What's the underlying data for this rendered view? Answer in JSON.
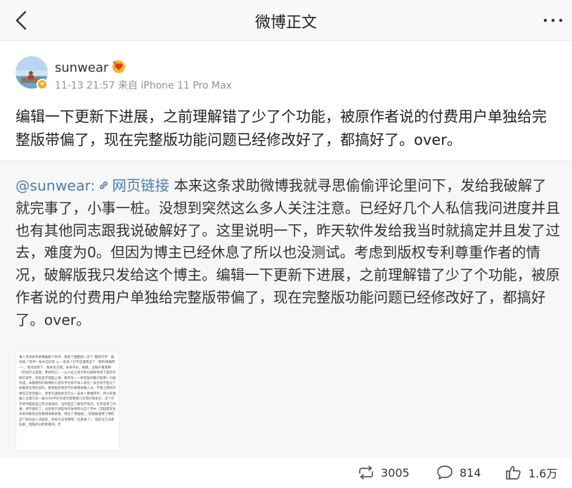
{
  "nav": {
    "title": "微博正文"
  },
  "post": {
    "author": "sunwear",
    "meta": "11-13 21:57 来自 iPhone 11 Pro Max",
    "verified_badge": "v",
    "text": "编辑一下更新下进展，之前理解错了少了个功能，被原作者说的付费用户单独给完整版带偏了，现在完整版功能问题已经修改好了，都搞好了。over。"
  },
  "repost": {
    "mention": "@sunwear:",
    "link_label": "网页链接",
    "text": " 本来这条求助微博我就寻思偷偷评论里问下，发给我破解了就完事了，小事一桩。没想到突然这么多人关注注意。已经好几个人私信我问进度并且也有其他同志跟我说破解好了。这里说明一下，昨天软件发给我当时就搞定并且发了过去，难度为0。但因为博主已经休息了所以也没测试。考虑到版权专利尊重作者的情况，破解版我只发给这个博主。编辑一下更新下进展，之前理解错了少了个功能，被原作者说的付费用户单独给完整版带偏了，现在完整版功能问题已经修改好了，都搞好了。over。",
    "image_text": "事人肖哥拿奖来堆破解个软件，我发下面配图一这个\"图标打字 - 画语病 !\"软件一拍水信的软 ◎ 一些本人打字是着用这个（我的病痛用一），情况说明下：我本名方瑞，身体不好，眼睛，过敏严重我种（有视可以是鲍，参视剂三）一从小说上述学目已被者有残下遗的字眼识得字，然后自学电脑上网，眼字等一一所有操作都只能用一只眼完成。本拥增有利病情的小说东字也常不本人者应一读这你不是为了拍着有去得的说的。最赞由软者在不中类网他输入法，不我上网的完硬在实装完输入，简单元通鼠标还可以一些本人硬着缺字。所以装遍输入太慢写多一篇1000字的文章可能需要几天而打刷本力。这个打字软件最是自己年对发接的。当时是应了解现字等的，也有是来了的事，拷不能的了。也新系不到软件开发者所以这个序中（求起累先生对果你看到这条看博请联系我，我也了把描贴），但能能兼用了博的这个知识本人法给起，简单元法或用啊（尤基来了），但是这方法拿些解，电脑的已断能着到，无"
  },
  "actions": {
    "repost_count": "3005",
    "comment_count": "814",
    "like_count": "1.6万"
  },
  "colors": {
    "link": "#507daf",
    "meta": "#939393",
    "repost_bg": "#f7f7f7",
    "verified": "#f6a623"
  },
  "icons": {
    "back": "chevron-left-icon",
    "more": "more-dots-icon",
    "vip": "vip-heart-icon",
    "link": "link-chain-icon",
    "repost": "repost-icon",
    "comment": "comment-bubble-icon",
    "like": "thumbs-up-icon"
  }
}
